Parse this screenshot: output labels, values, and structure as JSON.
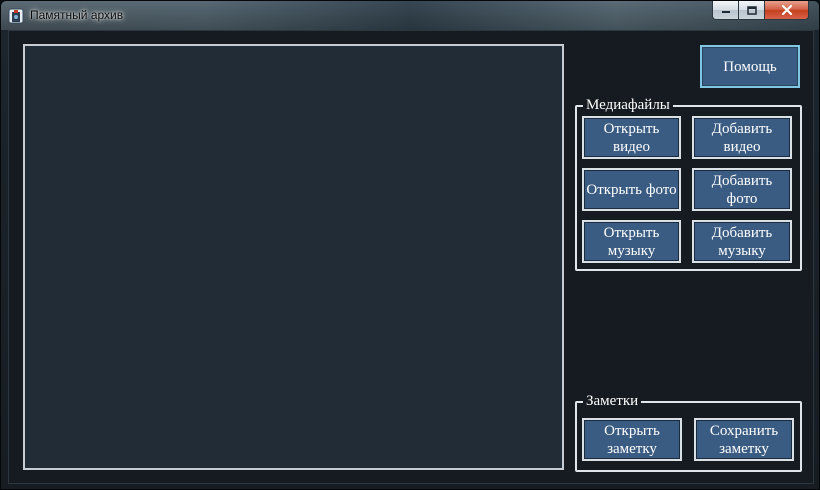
{
  "window": {
    "title": "Памятный архив",
    "icon": "app-archive-icon"
  },
  "caption_buttons": {
    "minimize_icon": "minimize-icon",
    "maximize_icon": "maximize-icon",
    "close_icon": "close-icon"
  },
  "help_button": {
    "label": "Помощь"
  },
  "media_group": {
    "title": "Медиафайлы",
    "buttons": [
      {
        "label": "Открыть видео"
      },
      {
        "label": "Добавить видео"
      },
      {
        "label": "Открыть фото"
      },
      {
        "label": "Добавить фото"
      },
      {
        "label": "Открыть музыку"
      },
      {
        "label": "Добавить музыку"
      }
    ]
  },
  "notes_group": {
    "title": "Заметки",
    "buttons": [
      {
        "label": "Открыть заметку"
      },
      {
        "label": "Сохранить заметку"
      }
    ]
  },
  "colors": {
    "button_fill": "#3b5c82",
    "help_border": "#7fc7e3",
    "viewer_bg": "#222c37",
    "window_bg": "#151b21"
  }
}
